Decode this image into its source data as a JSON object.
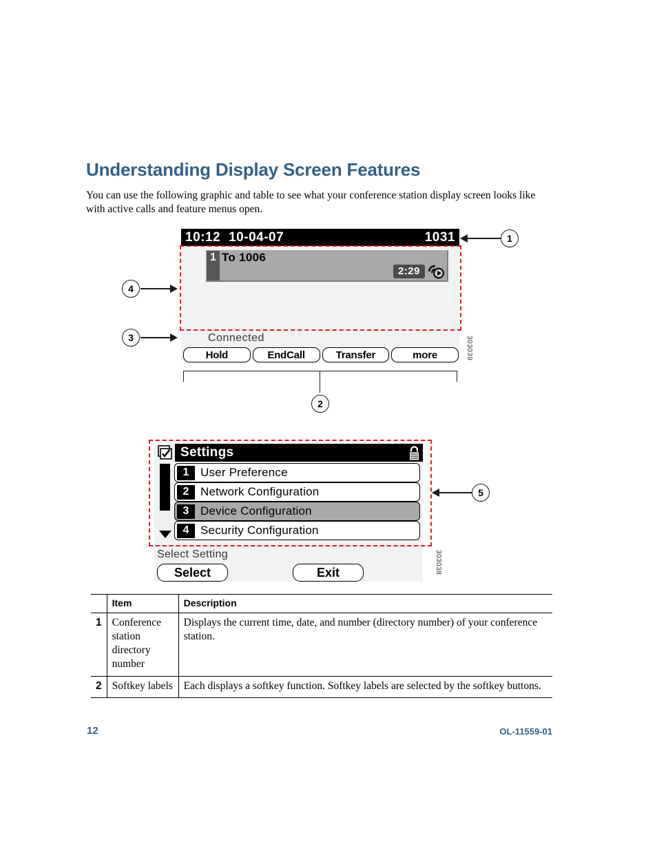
{
  "heading": "Understanding Display Screen Features",
  "intro": "You can use the following graphic and table to see what your conference station display screen looks like with active calls and feature menus open.",
  "figure_call": {
    "id_label": "303039",
    "header": {
      "time": "10:12",
      "date": "10-04-07",
      "directory_number": "1031"
    },
    "call": {
      "line_number": "1",
      "label": "To 1006",
      "duration": "2:29",
      "icon": "connected-call-icon"
    },
    "status": "Connected",
    "softkeys": [
      "Hold",
      "EndCall",
      "Transfer",
      "more"
    ],
    "callouts": [
      {
        "number": "1",
        "target": "header-bar"
      },
      {
        "number": "2",
        "target": "softkey-labels"
      },
      {
        "number": "3",
        "target": "status-line"
      },
      {
        "number": "4",
        "target": "call-activity-area"
      }
    ]
  },
  "figure_settings": {
    "id_label": "303038",
    "title": "Settings",
    "title_icon": "settings-checkbox-icon",
    "lock_icon": "padlock-icon",
    "items": [
      {
        "number": "1",
        "label": "User Preference",
        "selected": false
      },
      {
        "number": "2",
        "label": "Network Configuration",
        "selected": false
      },
      {
        "number": "3",
        "label": "Device Configuration",
        "selected": true
      },
      {
        "number": "4",
        "label": "Security Configuration",
        "selected": false
      }
    ],
    "prompt": "Select Setting",
    "softkeys": [
      "Select",
      "Exit"
    ],
    "callouts": [
      {
        "number": "5",
        "target": "feature-menu-area"
      }
    ]
  },
  "table": {
    "headers": [
      "",
      "Item",
      "Description"
    ],
    "rows": [
      {
        "num": "1",
        "item": "Conference station directory number",
        "description": "Displays the current time, date, and number (directory number) of your conference station."
      },
      {
        "num": "2",
        "item": "Softkey labels",
        "description": "Each displays a softkey function. Softkey labels are selected by the softkey buttons."
      }
    ]
  },
  "footer": {
    "page_number": "12",
    "doc_id": "OL-11559-01"
  },
  "colors": {
    "accent": "#336086",
    "highlight_dash": "#e8191b",
    "lcd_bg": "#f2f2f2",
    "selected_row": "#a9a9a9"
  }
}
